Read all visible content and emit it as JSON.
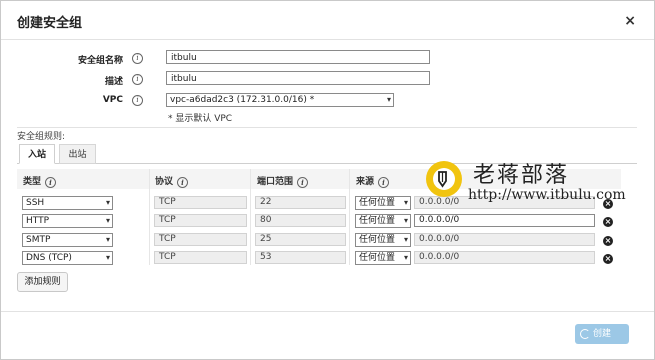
{
  "dialog": {
    "title": "创建安全组",
    "close": "×"
  },
  "form": {
    "name_label": "安全组名称",
    "name_value": "itbulu",
    "desc_label": "描述",
    "desc_value": "itbulu",
    "vpc_label": "VPC",
    "vpc_value": "vpc-a6dad2c3 (172.31.0.0/16) *",
    "vpc_note": "* 显示默认 VPC",
    "info": "i"
  },
  "rules": {
    "title": "安全组规则:",
    "tabs": [
      "入站",
      "出站"
    ],
    "columns": [
      "类型",
      "协议",
      "端口范围",
      "来源"
    ],
    "rows": [
      {
        "type": "SSH",
        "protocol": "TCP",
        "port": "22",
        "source": "任何位置",
        "cidr": "0.0.0.0/0"
      },
      {
        "type": "HTTP",
        "protocol": "TCP",
        "port": "80",
        "source": "任何位置",
        "cidr": "0.0.0.0/0"
      },
      {
        "type": "SMTP",
        "protocol": "TCP",
        "port": "25",
        "source": "任何位置",
        "cidr": "0.0.0.0/0"
      },
      {
        "type": "DNS (TCP)",
        "protocol": "TCP",
        "port": "53",
        "source": "任何位置",
        "cidr": "0.0.0.0/0"
      }
    ],
    "add_label": "添加规则"
  },
  "footer": {
    "create_label": "创建"
  },
  "watermark": {
    "title": "老蒋部落",
    "url": "http://www.itbulu.com"
  },
  "colors": {
    "primary_button": "#9cc8e6",
    "watermark_badge": "#f1c40f"
  }
}
